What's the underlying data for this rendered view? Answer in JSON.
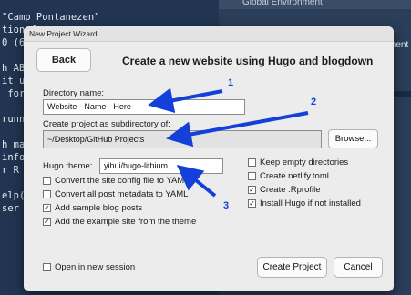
{
  "console": {
    "lines": [
      "\"Camp Pontanezen\"",
      "tion f",
      "0 (66",
      "",
      "h ABS",
      "it ur",
      " for c",
      "",
      "runnin",
      "",
      "h man",
      "inform",
      "r R pa",
      "",
      "elp()",
      "ser in"
    ]
  },
  "right_pane": {
    "env_text": "Global Environment",
    "side_text": "ment"
  },
  "dialog": {
    "window_title": "New Project Wizard",
    "back_label": "Back",
    "heading": "Create a new website using Hugo and blogdown",
    "dir_label": "Directory name:",
    "dir_value": "Website - Name - Here",
    "subdir_label": "Create project as subdirectory of:",
    "subdir_value": "~/Desktop/GitHub Projects",
    "browse_label": "Browse...",
    "theme_label": "Hugo theme:",
    "theme_value": "yihui/hugo-lithium",
    "left_options": [
      {
        "label": "Convert the site config file to YAML",
        "checked": false
      },
      {
        "label": "Convert all post metadata to YAML",
        "checked": false
      },
      {
        "label": "Add sample blog posts",
        "checked": true
      },
      {
        "label": "Add the example site from the theme",
        "checked": true
      }
    ],
    "right_options": [
      {
        "label": "Keep empty directories",
        "checked": false
      },
      {
        "label": "Create netlify.toml",
        "checked": false
      },
      {
        "label": "Create .Rprofile",
        "checked": true
      },
      {
        "label": "Install Hugo if not installed",
        "checked": true
      }
    ],
    "session_label": "Open in new session",
    "session_checked": false,
    "create_label": "Create Project",
    "cancel_label": "Cancel"
  },
  "annotations": {
    "one": "1",
    "two": "2",
    "three": "3",
    "color": "#1240d8"
  }
}
